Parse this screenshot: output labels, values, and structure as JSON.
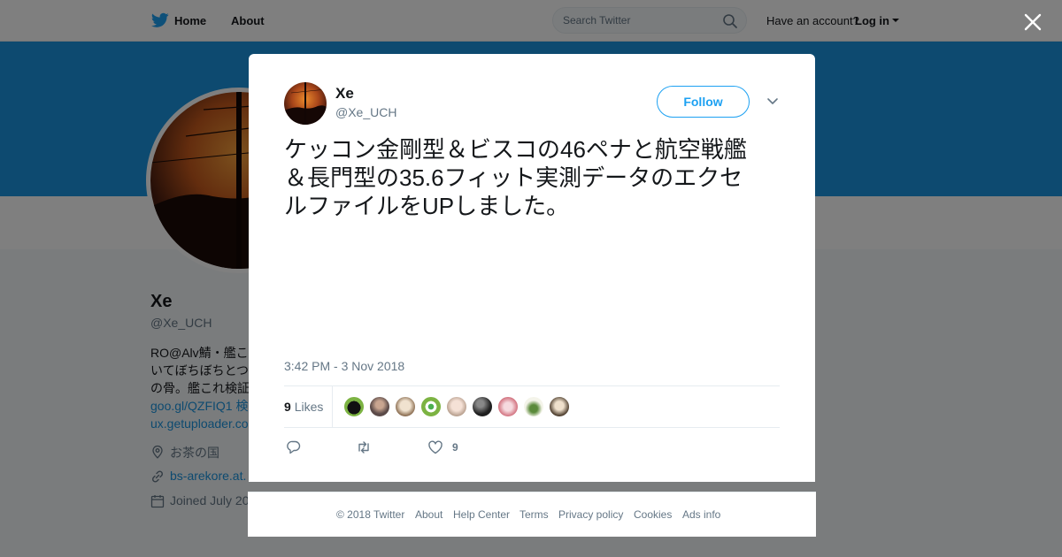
{
  "nav": {
    "home_label": "Home",
    "about_label": "About",
    "search_placeholder": "Search Twitter",
    "have_account": "Have an account?",
    "login_label": "Log in"
  },
  "profile": {
    "name": "Xe",
    "handle": "@Xe_UCH",
    "bio_lines": [
      "RO@Alv鯖・艦こ",
      "いてぼちぼちとつ",
      "の骨。艦これ検証",
      "goo.gl/QZFIQ1 検",
      "ux.getuploader.co"
    ],
    "location": "お茶の国",
    "website": "bs-arekore.at.",
    "joined": "Joined July 20"
  },
  "tweet": {
    "author_name": "Xe",
    "author_handle": "@Xe_UCH",
    "follow_label": "Follow",
    "text_lines": [
      "ケッコン金剛型＆ビスコの46ペナと航空戦艦",
      "＆長門型の35.6フィット実測データのエクセ",
      "ルファイルをUPしました。"
    ],
    "timestamp": "3:42 PM - 3 Nov 2018",
    "likes_count": "9",
    "likes_label": "Likes",
    "like_action_count": "9"
  },
  "footer": {
    "copyright": "© 2018 Twitter",
    "about": "About",
    "help": "Help Center",
    "terms": "Terms",
    "privacy": "Privacy policy",
    "cookies": "Cookies",
    "ads": "Ads info"
  },
  "colors": {
    "twitter_blue": "#1da1f2",
    "banner": "#1b95e0",
    "text": "#14171a",
    "muted": "#657786"
  },
  "icons": [
    "twitter-bird-icon",
    "search-icon",
    "close-icon",
    "chevron-down-icon",
    "location-icon",
    "link-icon",
    "calendar-icon",
    "reply-icon",
    "retweet-icon",
    "heart-icon"
  ]
}
